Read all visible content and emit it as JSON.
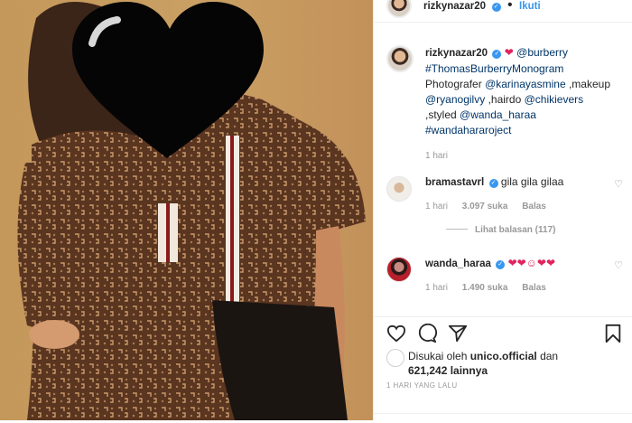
{
  "post": {
    "username": "rizkynazar20",
    "follow_label": "Ikuti",
    "caption": {
      "username": "rizkynazar20",
      "mention_brand": "@burberry",
      "hashtag_1": "#ThomasBurberryMonogram",
      "text_1": "Photografer",
      "mention_photo": "@karinayasmine",
      "text_2": ",makeup",
      "mention_makeup": "@ryanogilvy",
      "text_3": ",hairdo",
      "mention_hair": "@chikievers",
      "text_4": ",styled",
      "mention_style": "@wanda_haraa",
      "hashtag_2": "#wandahararoject",
      "time": "1 hari"
    },
    "comments": [
      {
        "username": "bramastavrl",
        "text": "gila gila gilaa",
        "time": "1 hari",
        "likes": "3.097 suka",
        "reply_label": "Balas"
      },
      {
        "username": "wanda_haraa",
        "text": "❤❤☺❤❤",
        "time": "1 hari",
        "likes": "1.490 suka",
        "reply_label": "Balas"
      }
    ],
    "view_replies": "Lihat balasan (117)",
    "liked_by_prefix": "Disukai oleh",
    "liked_by_user": "unico.official",
    "liked_by_and": "dan",
    "liked_by_count": "621,242 lainnya",
    "posted_ago": "1 HARI YANG LALU"
  },
  "colors": {
    "link": "#003569",
    "follow": "#3897f0",
    "verified": "#3897f0",
    "heart": "#e0245e",
    "muted": "#999999",
    "background_photo": "#c89c60"
  },
  "icons": [
    "heart-icon",
    "comment-icon",
    "share-icon",
    "bookmark-icon",
    "verified-icon"
  ]
}
